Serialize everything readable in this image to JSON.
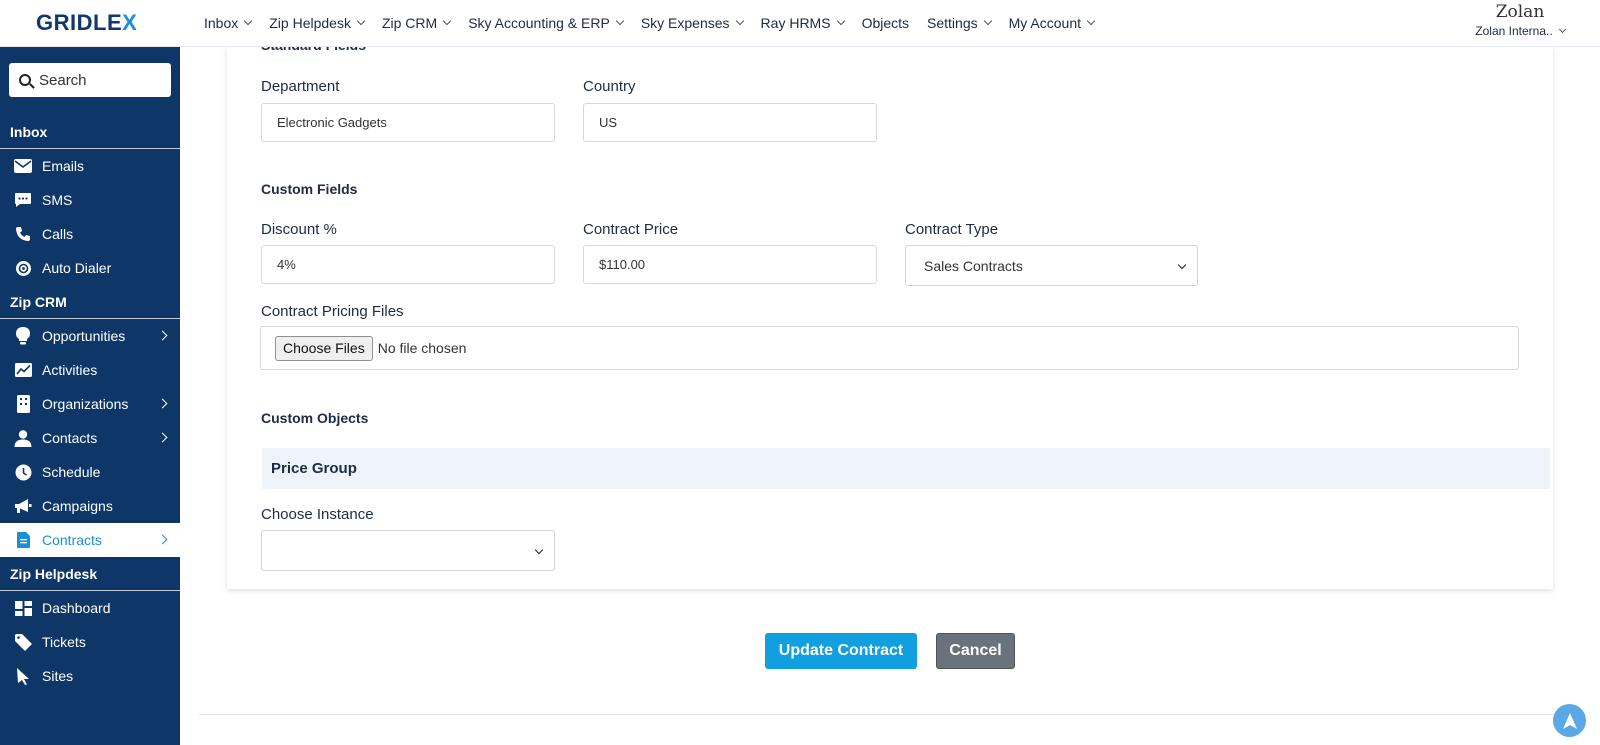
{
  "brand": {
    "logo_main": "GRIDLE",
    "logo_x": "X"
  },
  "topnav": [
    {
      "label": "Inbox",
      "dropdown": true
    },
    {
      "label": "Zip Helpdesk",
      "dropdown": true
    },
    {
      "label": "Zip CRM",
      "dropdown": true
    },
    {
      "label": "Sky Accounting & ERP",
      "dropdown": true
    },
    {
      "label": "Sky Expenses",
      "dropdown": true
    },
    {
      "label": "Ray HRMS",
      "dropdown": true
    },
    {
      "label": "Objects",
      "dropdown": false
    },
    {
      "label": "Settings",
      "dropdown": true
    },
    {
      "label": "My Account",
      "dropdown": true
    }
  ],
  "account": {
    "org_logo": "Zolan",
    "org_name": "Zolan Interna.."
  },
  "sidebar": {
    "search_label": "Search",
    "inbox_title": "Inbox",
    "inbox_items": [
      "Emails",
      "SMS",
      "Calls",
      "Auto Dialer"
    ],
    "crm_title": "Zip CRM",
    "crm_items": [
      "Opportunities",
      "Activities",
      "Organizations",
      "Contacts",
      "Schedule",
      "Campaigns",
      "Contracts"
    ],
    "helpdesk_title": "Zip Helpdesk",
    "helpdesk_items": [
      "Dashboard",
      "Tickets",
      "Sites"
    ]
  },
  "form": {
    "standard_heading": "Standard Fields",
    "department_label": "Department",
    "department_value": "Electronic Gadgets",
    "country_label": "Country",
    "country_value": "US",
    "custom_heading": "Custom Fields",
    "discount_label": "Discount %",
    "discount_value": "4%",
    "price_label": "Contract Price",
    "price_value": "$110.00",
    "type_label": "Contract Type",
    "type_value": "Sales Contracts",
    "files_label": "Contract Pricing Files",
    "files_button": "Choose Files",
    "files_status": "No file chosen",
    "objects_heading": "Custom Objects",
    "price_group": "Price Group",
    "instance_label": "Choose Instance",
    "instance_value": ""
  },
  "actions": {
    "update": "Update Contract",
    "cancel": "Cancel"
  },
  "colors": {
    "sidebar": "#0e3768",
    "accent": "#129fe0",
    "cancel": "#6a737d"
  }
}
